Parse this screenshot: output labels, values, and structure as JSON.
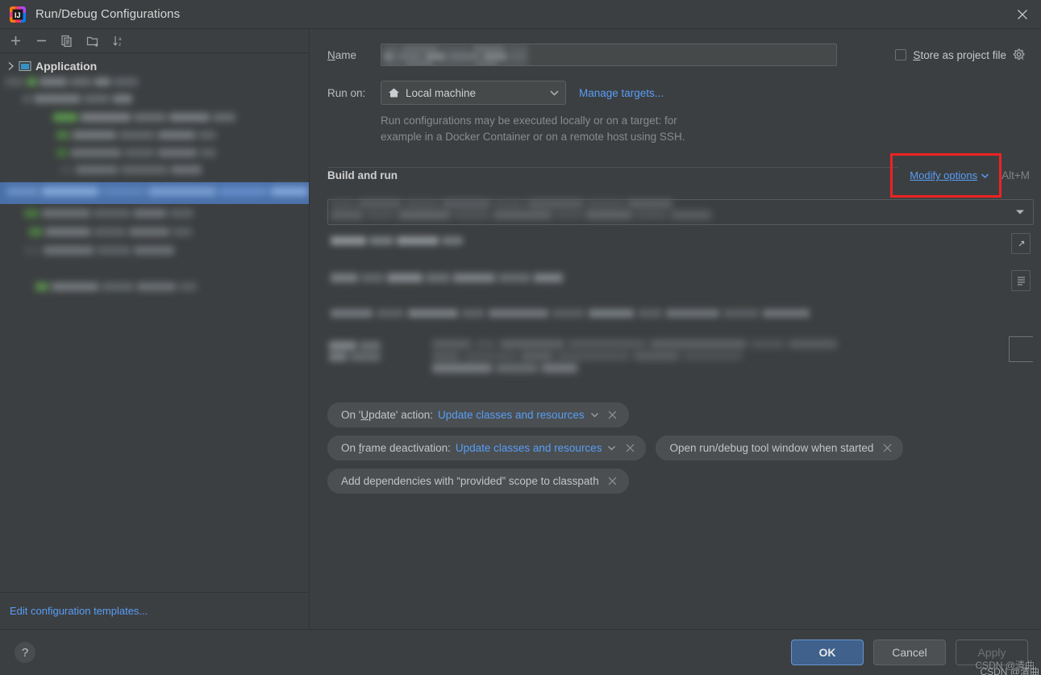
{
  "window": {
    "title": "Run/Debug Configurations",
    "logo_icon": "intellij-idea-logo",
    "close_icon": "close-icon"
  },
  "sidebar": {
    "toolbar": [
      {
        "name": "add-configuration-button",
        "icon": "plus-icon",
        "label": "+"
      },
      {
        "name": "remove-configuration-button",
        "icon": "minus-icon",
        "label": "−"
      },
      {
        "name": "copy-configuration-button",
        "icon": "copy-icon",
        "label": "Copy"
      },
      {
        "name": "new-folder-button",
        "icon": "new-folder-icon",
        "label": "New Folder"
      },
      {
        "name": "sort-configurations-button",
        "icon": "sort-alphabetically-icon",
        "label": "Sort"
      }
    ],
    "tree": {
      "root_label": "Application",
      "root_icon": "application-icon",
      "expand_icon": "chevron-right-icon",
      "child_count": 9,
      "selected_index": 5
    },
    "edit_templates_link": "Edit configuration templates..."
  },
  "form": {
    "name_label": "Name",
    "name_value": "",
    "store_as_project_file_label": "Store as project file",
    "store_as_project_file_checked": false,
    "store_gear_icon": "gear-dropdown-icon",
    "run_on_label": "Run on:",
    "run_on_value": "Local machine",
    "run_on_icon": "home-icon",
    "run_on_caret_icon": "chevron-down-icon",
    "manage_targets_link": "Manage targets...",
    "hint_line_1": "Run configurations may be executed locally or on a target: for",
    "hint_line_2": "example in a Docker Container or on a remote host using SSH."
  },
  "build_and_run": {
    "section_title": "Build and run",
    "modify_options_link": "Modify options",
    "modify_options_caret_icon": "chevron-down-icon",
    "modify_options_shortcut": "Alt+M",
    "field_dropdown_icon": "chevron-down-icon",
    "field_expand_icon": "expand-editor-icon",
    "field_list_icon": "macro-list-icon",
    "chips": [
      {
        "name": "chip-on-update-action",
        "label": "On 'Update' action:",
        "value": "Update classes and resources",
        "has_caret": true,
        "close_icon": "close-icon",
        "row": 0
      },
      {
        "name": "chip-on-frame-deactivation",
        "label": "On frame deactivation:",
        "value": "Update classes and resources",
        "has_caret": true,
        "close_icon": "close-icon",
        "row": 1
      },
      {
        "name": "chip-open-run-debug-tool-window",
        "label": "Open run/debug tool window when started",
        "value": "",
        "has_caret": false,
        "close_icon": "close-icon",
        "row": 1
      },
      {
        "name": "chip-add-provided-dependencies",
        "label": "Add dependencies with “provided” scope to classpath",
        "value": "",
        "has_caret": false,
        "close_icon": "close-icon",
        "row": 2
      }
    ]
  },
  "footer": {
    "help_label": "?",
    "ok_label": "OK",
    "cancel_label": "Cancel",
    "apply_label": "Apply",
    "watermark": "CSDN @清曲"
  },
  "annotation": {
    "highlight_color": "#ee2222",
    "target": "Modify options"
  },
  "colors": {
    "background": "#3c3f41",
    "panel_border": "#323232",
    "link_blue": "#589df6",
    "selection_blue": "#4a6fa8",
    "chip_background": "#4b4f51",
    "ok_button_blue": "#3f618c"
  }
}
